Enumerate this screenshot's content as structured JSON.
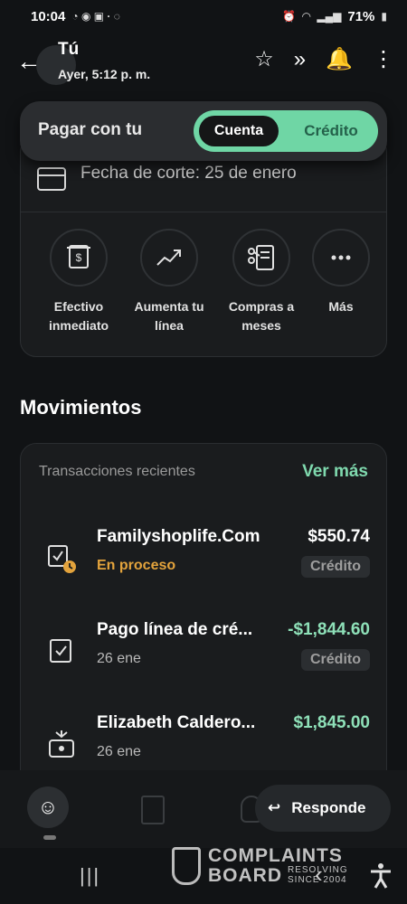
{
  "status_bar": {
    "time": "10:04",
    "battery": "71%"
  },
  "chat": {
    "name": "Tú",
    "time": "Ayer, 5:12 p. m."
  },
  "pay_toggle": {
    "label": "Pagar con tu",
    "options": [
      "Cuenta",
      "Crédito"
    ],
    "selected": "Cuenta"
  },
  "account": {
    "cutoff_text": "Fecha de corte: 25 de enero",
    "actions": [
      {
        "label_1": "Efectivo",
        "label_2": "inmediato",
        "icon": "cash-icon"
      },
      {
        "label_1": "Aumenta tu",
        "label_2": "línea",
        "icon": "trend-up-icon"
      },
      {
        "label_1": "Compras a",
        "label_2": "meses",
        "icon": "receipt-scissors-icon"
      },
      {
        "label_1": "Más",
        "label_2": "",
        "icon": "more-icon"
      }
    ]
  },
  "movimientos": {
    "title": "Movimientos",
    "recent_label": "Transacciones recientes",
    "see_more": "Ver más",
    "transactions": [
      {
        "name": "Familyshoplife.Com",
        "sub": "En proceso",
        "amount": "$550.74",
        "badge": "Crédito",
        "icon": "pending-check-icon"
      },
      {
        "name": "Pago línea de cré...",
        "sub": "26 ene",
        "amount": "-$1,844.60",
        "badge": "Crédito",
        "icon": "check-icon"
      },
      {
        "name": "Elizabeth Caldero...",
        "sub": "26 ene",
        "amount": "$1,845.00",
        "badge": "",
        "icon": "incoming-transfer-icon"
      }
    ]
  },
  "composer": {
    "reply_label": "Responde"
  },
  "watermark": {
    "line1": "COMPLAINTS",
    "line2": "BOARD",
    "tag1": "RESOLVING",
    "tag2": "SINCE 2004"
  },
  "colors": {
    "accent": "#6fd6a5",
    "pending": "#e3a33c",
    "positive": "#8ee0b8"
  }
}
